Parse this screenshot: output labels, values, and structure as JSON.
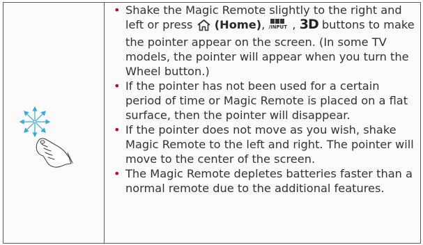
{
  "notes": {
    "n1": {
      "before": "Shake the Magic Remote slightly to the right and left or press ",
      "home_label": "(Home)",
      "comma1": ",",
      "input_label": "/INPUT",
      "comma2": ",",
      "three_d": "3D",
      "after": " buttons to make the pointer appear on the screen. (In some TV models, the pointer will appear when you turn the Wheel button.)"
    },
    "n2": "If the pointer has not been used for a certain period of time or Magic Remote is placed on a flat surface, then the pointer will disappear.",
    "n3": "If the pointer does not move as you wish, shake Magic Remote to the left and right. The pointer will move to the center of the screen.",
    "n4": "The Magic Remote depletes batteries faster than a normal remote due to the additional features."
  },
  "bullet_char": "•",
  "colors": {
    "bullet": "#c4004d",
    "text": "#333333",
    "pointer_arrows": "#33aadd",
    "border": "#5a5a5a"
  },
  "icons": {
    "illustration": "magic-remote-pointer-illustration",
    "home": "home-icon",
    "input": "input-icon",
    "three_d": "3d-button-icon"
  }
}
